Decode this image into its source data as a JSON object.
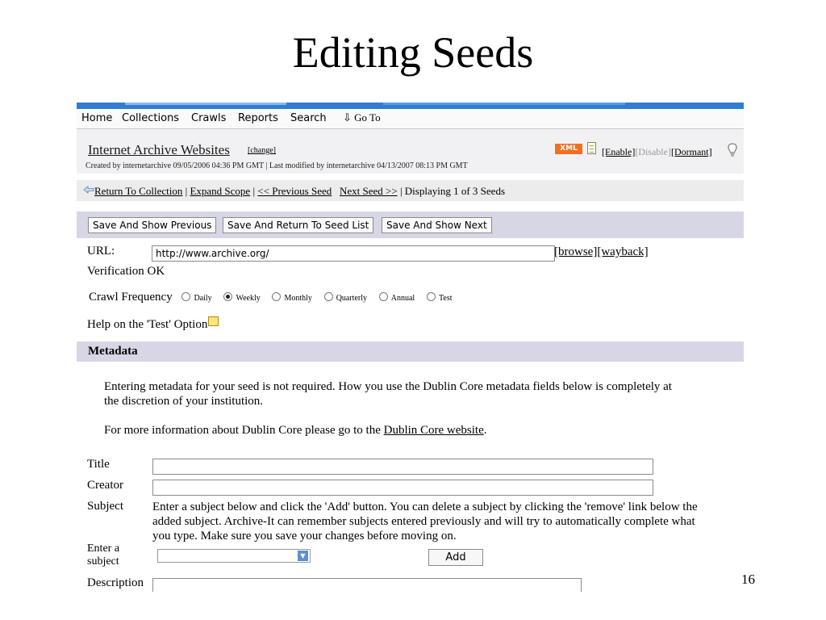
{
  "slide": {
    "title": "Editing Seeds",
    "number": "16"
  },
  "nav": {
    "items": [
      "Home",
      "Collections",
      "Crawls",
      "Reports",
      "Search"
    ],
    "goto_icon": "down-arrow-icon",
    "goto_label": "Go To"
  },
  "collection": {
    "name": "Internet Archive Websites",
    "change": "[change]",
    "meta": "Created by internetarchive 09/05/2006 04:36 PM GMT | Last modified by internetarchive 04/13/2007 08:13 PM GMT",
    "xml_badge": "XML",
    "enable": "[Enable]",
    "disable": "[Disable]",
    "dormant": "[Dormant]"
  },
  "seed_nav": {
    "return": "Return To Collection",
    "sep1": " | ",
    "expand": "Expand Scope",
    "sep2": " | ",
    "previous": "<< Previous Seed",
    "next": "Next Seed >>",
    "status": " | Displaying 1 of 3 Seeds"
  },
  "buttons": {
    "save_previous": "Save And Show Previous",
    "save_return": "Save And Return To Seed List",
    "save_next": "Save And Show Next"
  },
  "url": {
    "label": "URL:",
    "value": "http://www.archive.org/",
    "browse": "[browse]",
    "wayback": "[wayback]"
  },
  "verification": "Verification OK",
  "crawl_frequency": {
    "label": "Crawl Frequency",
    "options": [
      "Daily",
      "Weekly",
      "Monthly",
      "Quarterly",
      "Annual",
      "Test"
    ],
    "selected": "Weekly"
  },
  "help_test": "Help on the 'Test' Option",
  "metadata": {
    "heading": "Metadata",
    "intro_line1": "Entering metadata for your seed is not required. How you use the Dublin Core metadata fields below is completely at",
    "intro_line2": "the discretion of your institution.",
    "more_info_prefix": "For more information about Dublin Core please go to the ",
    "more_info_link": "Dublin Core website",
    "more_info_suffix": ".",
    "title_label": "Title",
    "creator_label": "Creator",
    "subject_label": "Subject",
    "subject_help_line1": "Enter a subject below and click the 'Add' button. You can delete a subject by clicking the 'remove' link below the",
    "subject_help_line2": "added subject. Archive-It can remember subjects entered previously and will try to automatically complete what",
    "subject_help_line3": "you type. Make sure you save your changes before moving on.",
    "enter_subject_line1": "Enter a",
    "enter_subject_line2": "subject",
    "add_label": "Add",
    "description_label": "Description"
  },
  "colors": {
    "accent_blue": "#2f7ed0",
    "band_lavender": "#d6d6e6",
    "xml_orange": "#f26f1f"
  }
}
